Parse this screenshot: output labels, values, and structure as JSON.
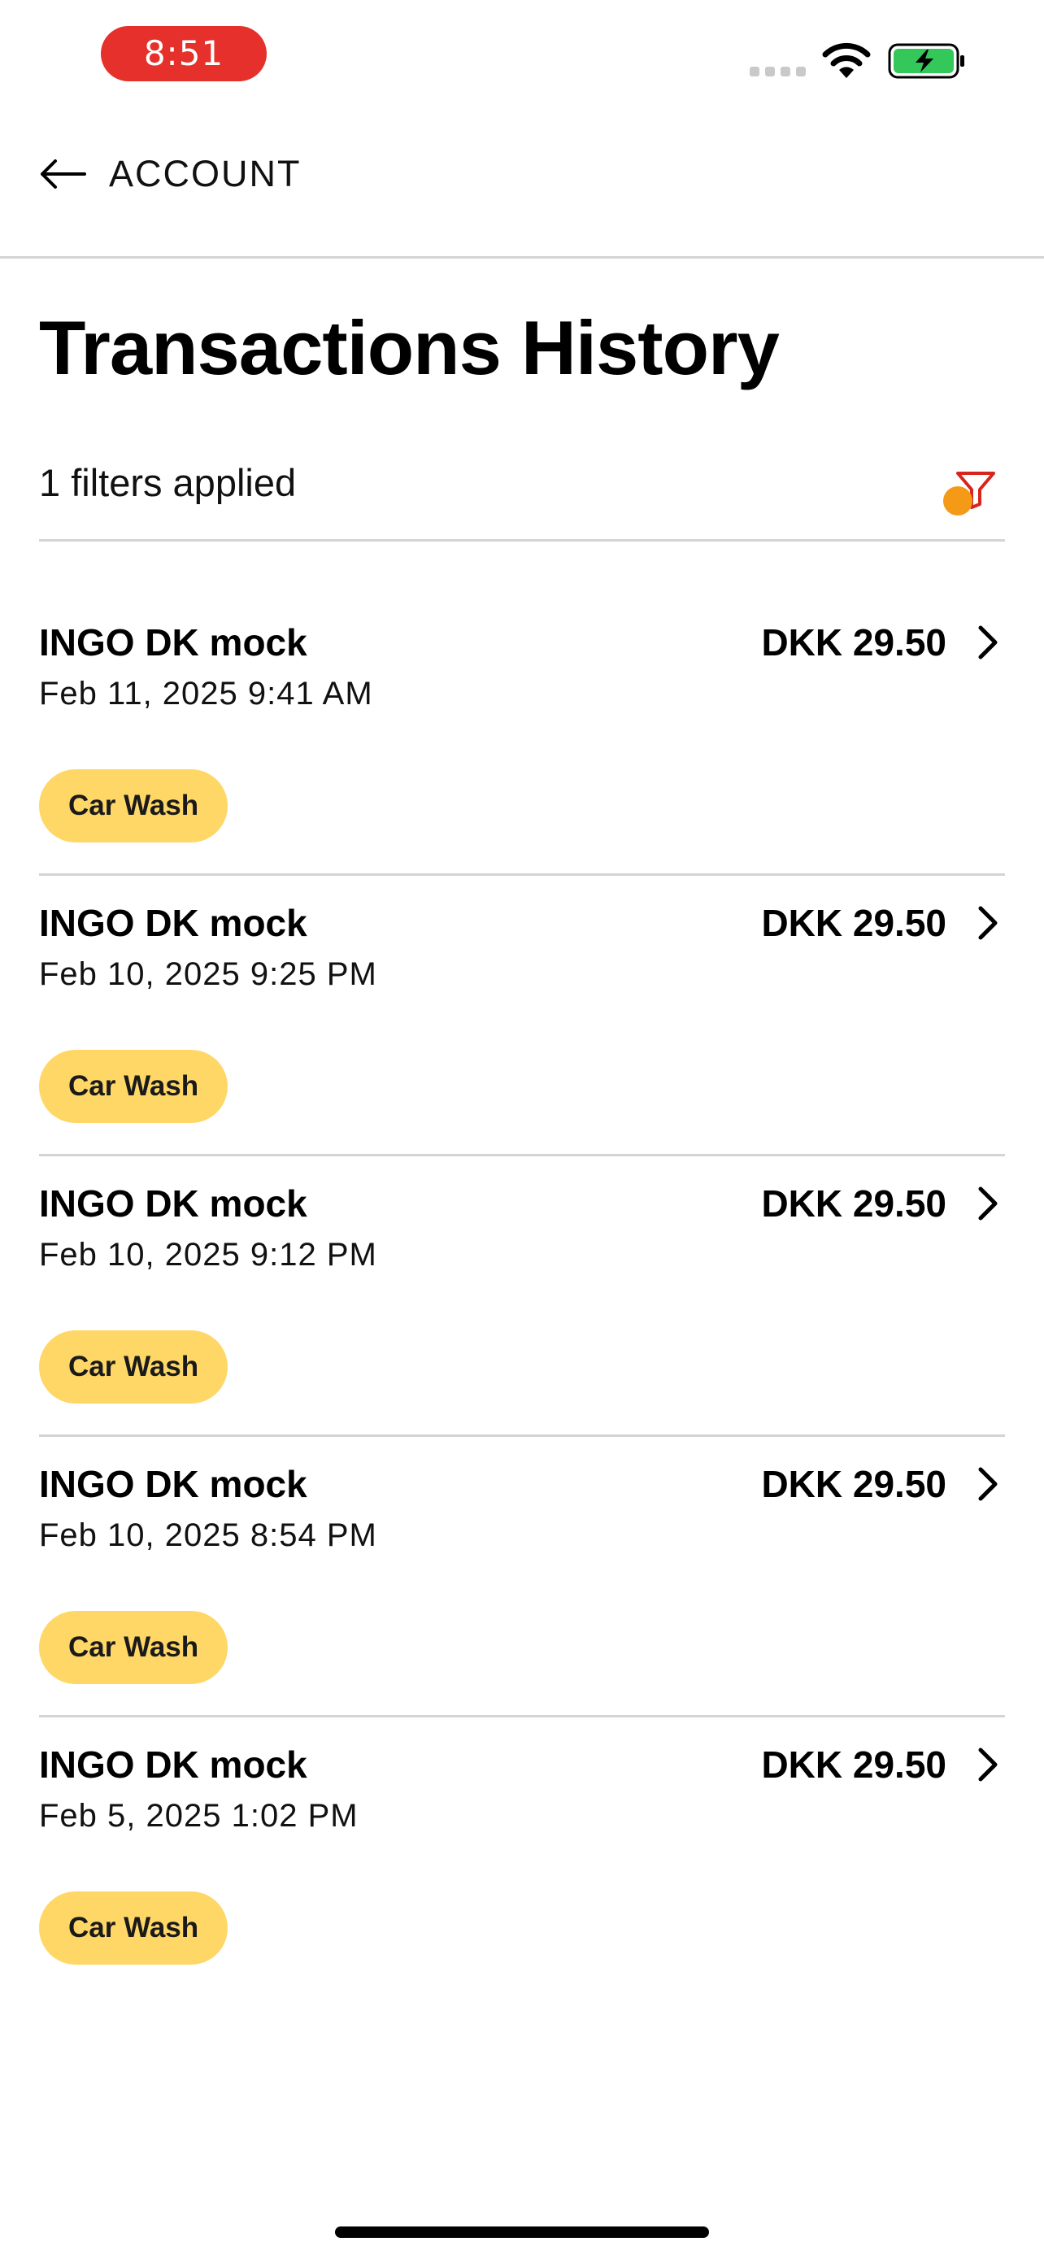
{
  "status_bar": {
    "time": "8:51",
    "time_pill_color": "#e5302b",
    "icons": [
      "cellular-signal-icon",
      "wifi-icon",
      "battery-charging-icon"
    ],
    "battery_color": "#34c759"
  },
  "nav": {
    "back_icon": "arrow-left-icon",
    "back_label": "ACCOUNT"
  },
  "page": {
    "title": "Transactions History"
  },
  "filters": {
    "label": "1 filters applied",
    "icon": "filter-icon",
    "indicator_color": "#f59a17",
    "icon_color": "#d7251d"
  },
  "tag_color": "#fed766",
  "transactions": [
    {
      "merchant": "INGO DK mock",
      "date": "Feb 11, 2025 9:41 AM",
      "amount": "DKK 29.50",
      "tag": "Car Wash"
    },
    {
      "merchant": "INGO DK mock",
      "date": "Feb 10, 2025 9:25 PM",
      "amount": "DKK 29.50",
      "tag": "Car Wash"
    },
    {
      "merchant": "INGO DK mock",
      "date": "Feb 10, 2025 9:12 PM",
      "amount": "DKK 29.50",
      "tag": "Car Wash"
    },
    {
      "merchant": "INGO DK mock",
      "date": "Feb 10, 2025 8:54 PM",
      "amount": "DKK 29.50",
      "tag": "Car Wash"
    },
    {
      "merchant": "INGO DK mock",
      "date": "Feb 5, 2025 1:02 PM",
      "amount": "DKK 29.50",
      "tag": "Car Wash"
    }
  ]
}
